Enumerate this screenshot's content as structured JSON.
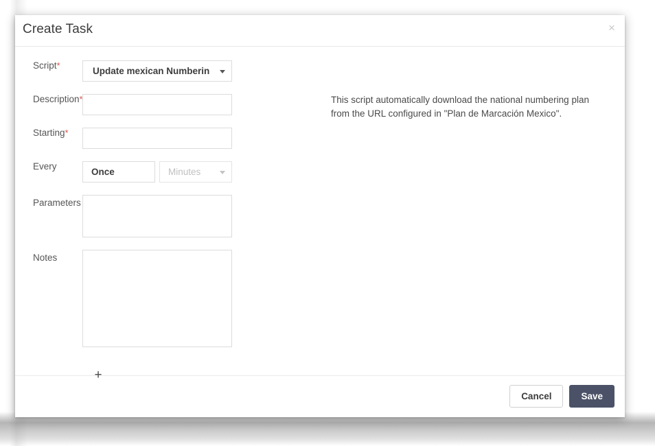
{
  "modal": {
    "title": "Create Task",
    "close_icon": "close-icon",
    "close_glyph": "×"
  },
  "form": {
    "script": {
      "label": "Script",
      "required_marker": "*",
      "selected": "Update mexican Numberin",
      "caret_icon": "chevron-down-icon"
    },
    "description": {
      "label": "Description",
      "required_marker": "*",
      "value": "",
      "placeholder": ""
    },
    "starting": {
      "label": "Starting",
      "required_marker": "*",
      "value": "",
      "placeholder": ""
    },
    "every": {
      "label": "Every",
      "frequency_value": "Once",
      "unit_value": "Minutes",
      "unit_caret_icon": "chevron-down-icon"
    },
    "parameters": {
      "label": "Parameters",
      "value": "",
      "placeholder": ""
    },
    "notes": {
      "label": "Notes",
      "value": "",
      "placeholder": ""
    },
    "add_row": {
      "icon": "plus-icon",
      "glyph": "+"
    }
  },
  "help": {
    "script_description": "This script automatically download the national numbering plan from the URL configured in \"Plan de Marcación Mexico\"."
  },
  "footer": {
    "cancel_label": "Cancel",
    "save_label": "Save"
  },
  "colors": {
    "save_button": "#4b5268",
    "required_asterisk": "#d9534f",
    "border": "#dcdcdc"
  }
}
